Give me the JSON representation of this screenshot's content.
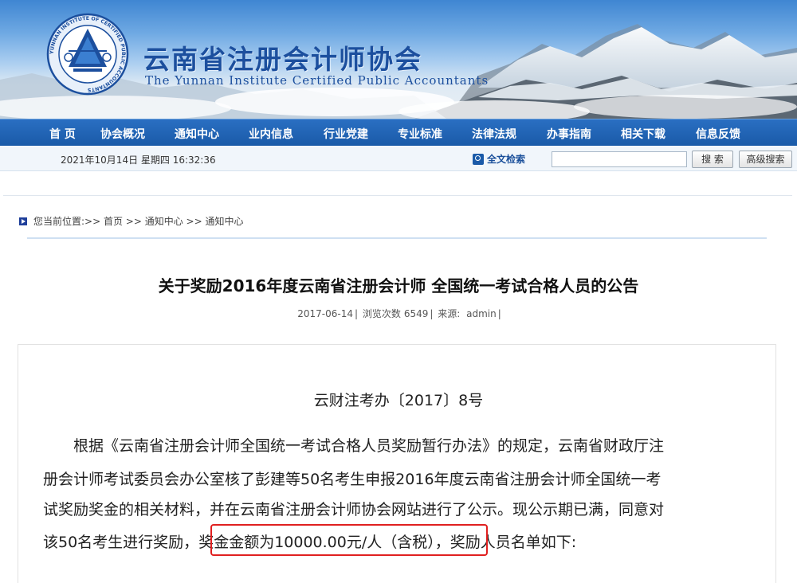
{
  "header": {
    "site_name_zh": "云南省注册会计师协会",
    "site_name_en": "The Yunnan Institute Certified Public Accountants",
    "logo_text": "YUNNAN INSTITUTE OF CERTIFIED PUBLIC ACCOUNTANTS"
  },
  "nav": {
    "items": [
      {
        "label": "首 页"
      },
      {
        "label": "协会概况"
      },
      {
        "label": "通知中心"
      },
      {
        "label": "业内信息"
      },
      {
        "label": "行业党建"
      },
      {
        "label": "专业标准"
      },
      {
        "label": "法律法规"
      },
      {
        "label": "办事指南"
      },
      {
        "label": "相关下载"
      },
      {
        "label": "信息反馈"
      }
    ]
  },
  "topbar": {
    "datetime": "2021年10月14日 星期四 16:32:36",
    "fulltext_label": "全文检索",
    "search_value": "",
    "search_button": "搜 索",
    "advanced_button": "高级搜索"
  },
  "breadcrumb": {
    "text": "您当前位置:>> 首页 >> 通知中心 >> 通知中心"
  },
  "article": {
    "title": "关于奖励2016年度云南省注册会计师 全国统一考试合格人员的公告",
    "date": "2017-06-14",
    "views_label": "浏览次数",
    "views": "6549",
    "source_label": "来源:",
    "source": "admin",
    "doc_no": "云财注考办〔2017〕8号",
    "lines": [
      "　　根据《云南省注册会计师全国统一考试合格人员奖励暂行办法》的规定，云南省财政厅注",
      "册会计师考试委员会办公室核了彭建等50名考生申报2016年度云南省注册会计师全国统一考",
      "试奖励奖金的相关材料，并在云南省注册会计师协会网站进行了公示。现公示期已满，同意对"
    ],
    "last_line_start": "该50名考生进行奖励，",
    "last_line_highlight": "奖金金额为10000.00元/人（含税）",
    "last_line_end": "，奖励人员名单如下:"
  },
  "colors": {
    "nav_bg": "#1a5aa8",
    "title_text": "#1c4f9e",
    "highlight_border": "#e02020"
  }
}
